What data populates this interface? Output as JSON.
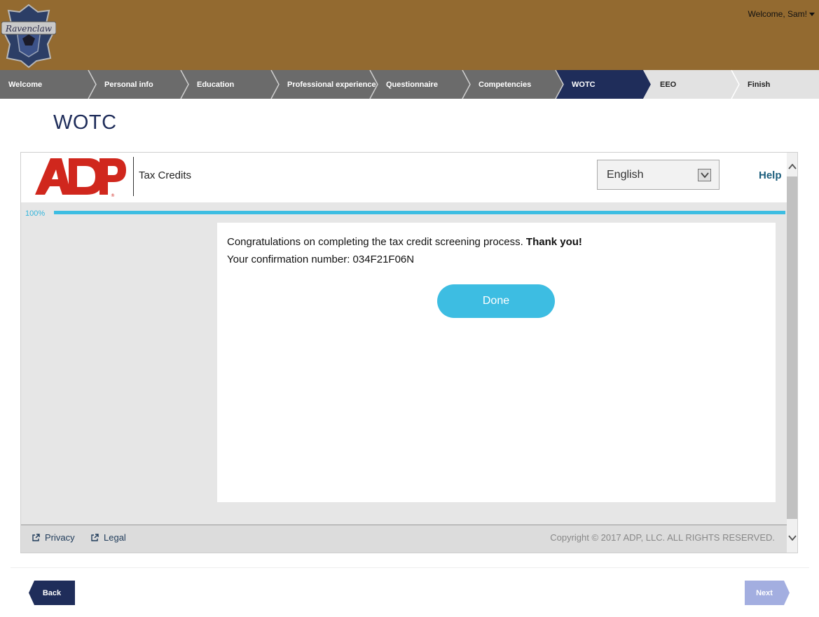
{
  "header": {
    "logo_name": "ravenclaw-crest",
    "welcome_text": "Welcome, Sam!"
  },
  "steps": [
    {
      "label": "Welcome",
      "state": "done"
    },
    {
      "label": "Personal info",
      "state": "done"
    },
    {
      "label": "Education",
      "state": "done"
    },
    {
      "label": "Professional experience",
      "state": "done"
    },
    {
      "label": "Questionnaire",
      "state": "done"
    },
    {
      "label": "Competencies",
      "state": "done"
    },
    {
      "label": "WOTC",
      "state": "current"
    },
    {
      "label": "EEO",
      "state": "todo"
    },
    {
      "label": "Finish",
      "state": "todo"
    }
  ],
  "page": {
    "title": "WOTC"
  },
  "frame": {
    "brand": "ADP",
    "product": "Tax Credits",
    "language": "English",
    "help_label": "Help",
    "progress_label": "100%",
    "progress_value": 100,
    "message_prefix": "Congratulations on completing the tax credit screening process.",
    "message_bold": "Thank you!",
    "confirmation_text": "Your confirmation number: 034F21F06N",
    "done_label": "Done",
    "footer": {
      "privacy_label": "Privacy",
      "legal_label": "Legal",
      "copyright": "Copyright © 2017 ADP, LLC. ALL RIGHTS RESERVED."
    }
  },
  "nav": {
    "back_label": "Back",
    "next_label": "Next"
  },
  "colors": {
    "header_bg": "#936a30",
    "step_done": "#6b6b6b",
    "step_current": "#1f2d5a",
    "step_todo": "#e2e2e2",
    "accent": "#3dbde2",
    "adp_red": "#d0271d",
    "back_btn": "#1f2d5a",
    "next_btn": "#a3aee0"
  }
}
